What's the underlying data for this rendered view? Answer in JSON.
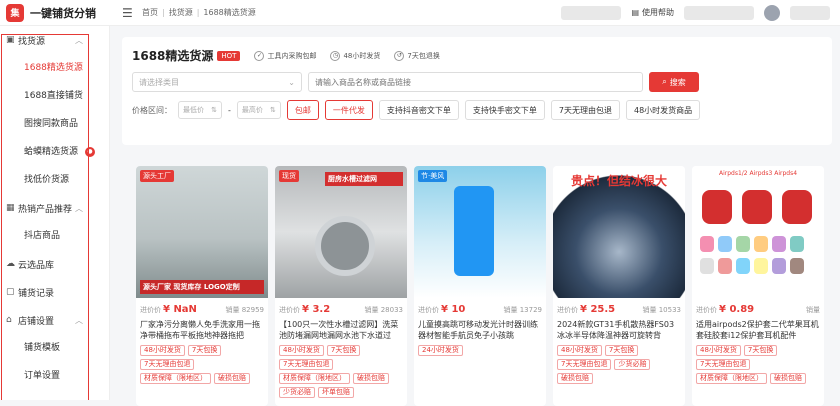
{
  "topbar": {
    "logo_mark": "集",
    "logo_text": "一键铺货分销",
    "breadcrumb": [
      "首页",
      "找货源",
      "1688精选货源"
    ],
    "help_label": "使用帮助"
  },
  "sidebar": {
    "groups": [
      {
        "label": "找货源",
        "items": [
          "1688精选货源",
          "1688直接铺货",
          "图搜同款商品",
          "蛤蟆精选货源",
          "找低价货源"
        ]
      },
      {
        "label": "热销产品推荐",
        "items": [
          "抖店商品"
        ]
      },
      {
        "label": "云选品库",
        "items": []
      },
      {
        "label": "铺货记录",
        "items": []
      },
      {
        "label": "店铺设置",
        "items": [
          "铺货模板",
          "订单设置"
        ]
      }
    ]
  },
  "filter": {
    "title": "1688精选货源",
    "hot": "HOT",
    "features": [
      "工具内采购包邮",
      "48小时发货",
      "7天包退换"
    ],
    "category_placeholder": "请选择类目",
    "search_placeholder": "请输入商品名称或商品链接",
    "search_button": "搜索",
    "price_label": "价格区间：",
    "price_min": "最低价",
    "price_max": "最高价",
    "chips": [
      "包邮",
      "一件代发",
      "支持抖音密文下单",
      "支持快手密文下单",
      "7天无理由包退",
      "48小时发货商品"
    ]
  },
  "products": [
    {
      "image_caption": "源头厂家  现货库存  LOGO定制",
      "corner_label": "源头工厂",
      "price_prefix": "进价价",
      "price": "¥ NaN",
      "sales_label": "销量",
      "sales": "82959",
      "title": "厂家净污分离懒人免手洗家用一拖净带桶拖布平板拖地神器拖把",
      "tags": [
        "48小时发货",
        "7天包换",
        "7天无理由包退",
        "材质保障（限地区）",
        "破损包赔"
      ]
    },
    {
      "image_caption": "厨房水槽过滤网",
      "corner_label": "现货",
      "price_prefix": "进价价",
      "price": "¥ 3.2",
      "sales_label": "销量",
      "sales": "28033",
      "title": "【100只一次性水槽过滤网】洗菜池防堵漏网地漏网水池下水道过",
      "tags": [
        "48小时发货",
        "7天包换",
        "7天无理由包退",
        "材质保障（限地区）",
        "破损包赔",
        "少货必赔",
        "坏单包赔"
      ]
    },
    {
      "image_caption": "手机壳",
      "corner_label": "节·美风",
      "price_prefix": "进价价",
      "price": "¥ 10",
      "sales_label": "销量",
      "sales": "13729",
      "title": "儿童摸高跳可移动发光计时器训练器材智能手航员免子小孩跳",
      "tags": [
        "24小时发货"
      ]
    },
    {
      "image_caption": "贵点！但结冰很大",
      "corner_label": "",
      "price_prefix": "进价价",
      "price": "¥ 25.5",
      "sales_label": "销量",
      "sales": "10533",
      "title": "2024新款GT31手机散热器FS03冰冰半导体降温神器可旋转背",
      "tags": [
        "48小时发货",
        "7天包换",
        "7天无理由包退",
        "少货必赔",
        "破损包赔"
      ]
    },
    {
      "image_caption": "Airpds1/2  Airpds3  Airpds4",
      "corner_label": "",
      "price_prefix": "进价价",
      "price": "¥ 0.89",
      "sales_label": "销量",
      "sales": "",
      "title": "适用airpods2保护套二代苹果耳机套硅胶套i12保护套耳机配件",
      "tags": [
        "48小时发货",
        "7天包换",
        "7天无理由包退",
        "材质保障（限地区）",
        "破损包赔"
      ]
    }
  ]
}
